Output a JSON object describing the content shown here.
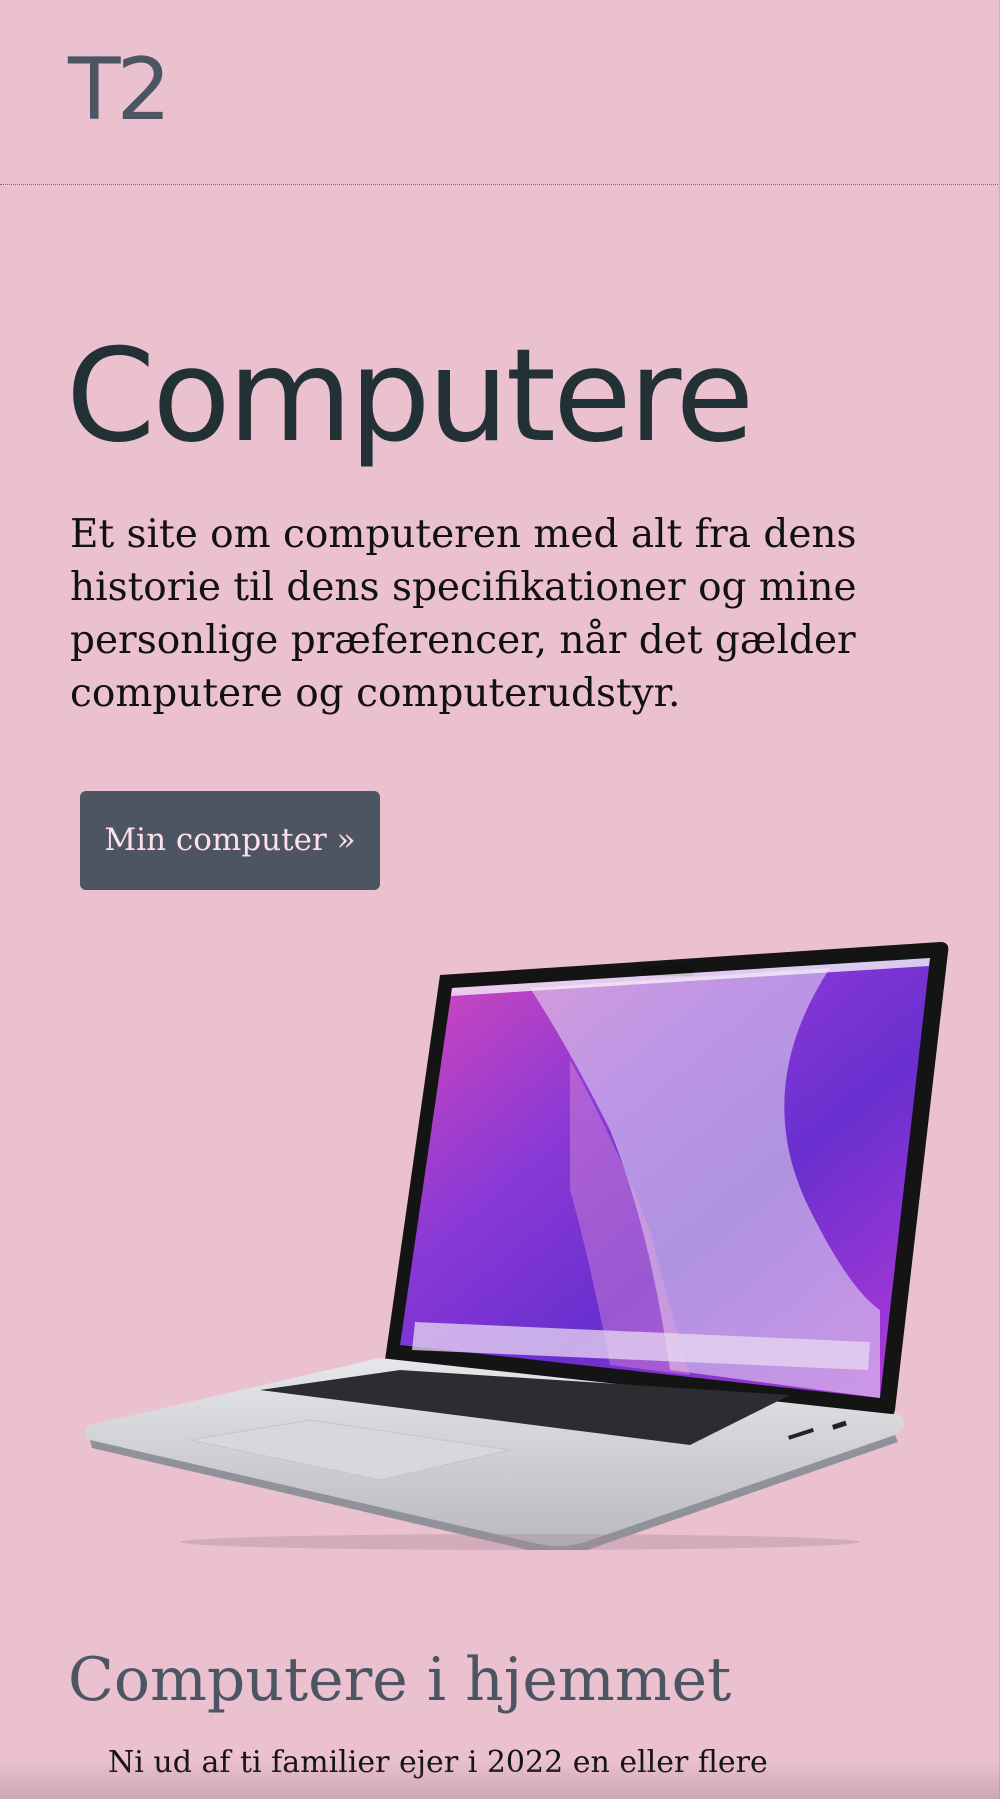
{
  "header": {
    "logo": "T2"
  },
  "hero": {
    "title": "Computere",
    "intro": "Et site om computeren med alt fra dens historie til dens specifikationer og mine personlige præferencer, når det gælder computere og computerudstyr.",
    "button_label": "Min computer »"
  },
  "section": {
    "title": "Computere i hjemmet",
    "text": "Ni ud af ti familier ejer i 2022 en eller flere"
  },
  "colors": {
    "background": "#ebc1cf",
    "button": "#4d5562",
    "heading": "#223135",
    "logo": "#4b5563"
  }
}
